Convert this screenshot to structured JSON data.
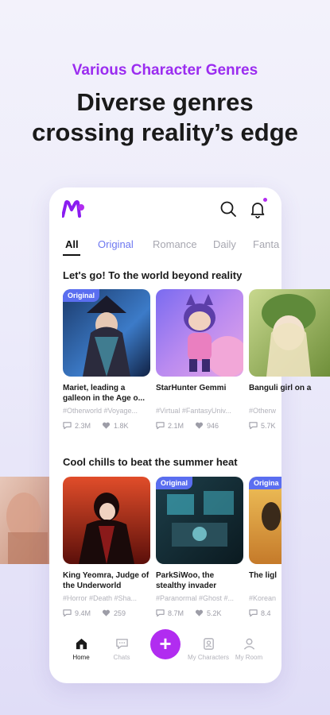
{
  "promo": {
    "subtitle": "Various Character Genres",
    "title_line1": "Diverse genres",
    "title_line2": "crossing reality’s edge"
  },
  "header": {
    "icons": [
      "logo-icon",
      "search-icon",
      "bell-icon"
    ],
    "has_notification": true
  },
  "tabs": [
    {
      "label": "All",
      "active": true
    },
    {
      "label": "Original"
    },
    {
      "label": "Romance"
    },
    {
      "label": "Daily"
    },
    {
      "label": "Fanta"
    }
  ],
  "sections": [
    {
      "title": "Let's go! To the world beyond reality",
      "cards": [
        {
          "badge": "Original",
          "title": "Mariet, leading a galleon in the Age o...",
          "tags": "#Otherworld #Voyage...",
          "chats": "2.3M",
          "likes": "1.8K"
        },
        {
          "badge": "",
          "title": "StarHunter Gemmi",
          "tags": "#Virtual #FantasyUniv...",
          "chats": "2.1M",
          "likes": "946"
        },
        {
          "badge": "",
          "title": "Banguli girl on a",
          "tags": "#Otherw",
          "chats": "5.7K",
          "likes": ""
        }
      ]
    },
    {
      "title": "Cool chills to beat the summer heat",
      "cards": [
        {
          "badge": "",
          "title": "King Yeomra, Judge of the Underworld",
          "tags": "#Horror #Death #Sha...",
          "chats": "9.4M",
          "likes": "259"
        },
        {
          "badge": "Original",
          "title": "ParkSiWoo, the stealthy invader",
          "tags": "#Paranormal #Ghost #...",
          "chats": "8.7M",
          "likes": "5.2K"
        },
        {
          "badge": "Origina",
          "title": "The ligl",
          "tags": "#Korean",
          "chats": "8.4",
          "likes": ""
        }
      ]
    }
  ],
  "bottom_nav": [
    {
      "label": "Home",
      "icon": "home-icon",
      "active": true
    },
    {
      "label": "Chats",
      "icon": "chat-bubble-icon"
    },
    {
      "label": "",
      "icon": "plus-icon"
    },
    {
      "label": "My Characters",
      "icon": "character-card-icon"
    },
    {
      "label": "My Room",
      "icon": "person-icon"
    }
  ],
  "fab_symbol": "+",
  "colors": {
    "accent_purple": "#b12cf0",
    "original_blue": "#5a6ef0",
    "promo_purple": "#9b2cf0"
  }
}
